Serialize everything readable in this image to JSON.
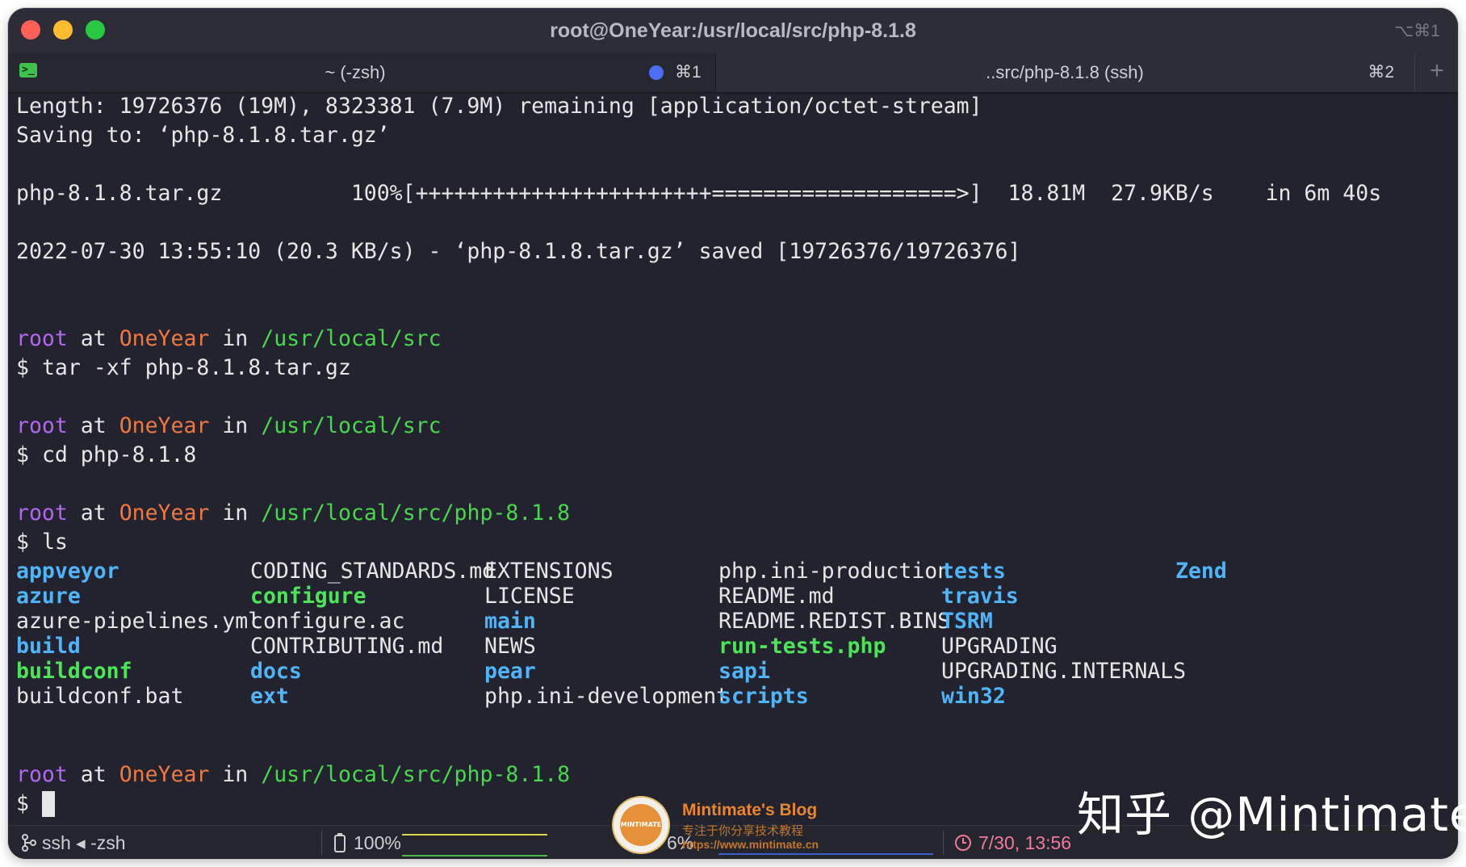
{
  "window": {
    "title": "root@OneYear:/usr/local/src/php-8.1.8",
    "shortcut": "⌥⌘1"
  },
  "tabs": [
    {
      "label": "~ (-zsh)",
      "shortcut": "⌘1"
    },
    {
      "label": "..src/php-8.1.8 (ssh)",
      "shortcut": "⌘2"
    }
  ],
  "tab_add_label": "+",
  "terminal": {
    "download": {
      "length_line": "Length: 19726376 (19M), 8323381 (7.9M) remaining [application/octet-stream]",
      "saving_line": "Saving to: ‘php-8.1.8.tar.gz’",
      "progress_line": "php-8.1.8.tar.gz          100%[+++++++++++++++++++++++===================>]  18.81M  27.9KB/s    in 6m 40s",
      "saved_line": "2022-07-30 13:55:10 (20.3 KB/s) - ‘php-8.1.8.tar.gz’ saved [19726376/19726376]"
    },
    "prompt": {
      "user": "root",
      "at": "at",
      "host": "OneYear",
      "in": "in",
      "symbol": "$"
    },
    "paths": {
      "src": "/usr/local/src",
      "php": "/usr/local/src/php-8.1.8"
    },
    "commands": [
      "tar -xf php-8.1.8.tar.gz",
      "cd php-8.1.8",
      "ls"
    ],
    "ls_columns": [
      [
        {
          "name": "appveyor",
          "kind": "dir"
        },
        {
          "name": "azure",
          "kind": "dir"
        },
        {
          "name": "azure-pipelines.yml",
          "kind": "file"
        },
        {
          "name": "build",
          "kind": "dir"
        },
        {
          "name": "buildconf",
          "kind": "exec"
        },
        {
          "name": "buildconf.bat",
          "kind": "file"
        }
      ],
      [
        {
          "name": "CODING_STANDARDS.md",
          "kind": "file"
        },
        {
          "name": "configure",
          "kind": "exec"
        },
        {
          "name": "configure.ac",
          "kind": "file"
        },
        {
          "name": "CONTRIBUTING.md",
          "kind": "file"
        },
        {
          "name": "docs",
          "kind": "dir"
        },
        {
          "name": "ext",
          "kind": "dir"
        }
      ],
      [
        {
          "name": "EXTENSIONS",
          "kind": "file"
        },
        {
          "name": "LICENSE",
          "kind": "file"
        },
        {
          "name": "main",
          "kind": "dir"
        },
        {
          "name": "NEWS",
          "kind": "file"
        },
        {
          "name": "pear",
          "kind": "dir"
        },
        {
          "name": "php.ini-development",
          "kind": "file"
        }
      ],
      [
        {
          "name": "php.ini-production",
          "kind": "file"
        },
        {
          "name": "README.md",
          "kind": "file"
        },
        {
          "name": "README.REDIST.BINS",
          "kind": "file"
        },
        {
          "name": "run-tests.php",
          "kind": "exec"
        },
        {
          "name": "sapi",
          "kind": "dir"
        },
        {
          "name": "scripts",
          "kind": "dir"
        }
      ],
      [
        {
          "name": "tests",
          "kind": "dir"
        },
        {
          "name": "travis",
          "kind": "dir"
        },
        {
          "name": "TSRM",
          "kind": "dir"
        },
        {
          "name": "UPGRADING",
          "kind": "file"
        },
        {
          "name": "UPGRADING.INTERNALS",
          "kind": "file"
        },
        {
          "name": "win32",
          "kind": "dir"
        }
      ],
      [
        {
          "name": "Zend",
          "kind": "dir"
        }
      ]
    ]
  },
  "statusbar": {
    "job": "ssh ◂ -zsh",
    "battery": "100%",
    "cpu": "6%",
    "clock": "7/30, 13:56"
  },
  "watermark": {
    "zhihu": "知乎 @Mintimate",
    "blog_title": "Mintimate's Blog",
    "blog_sub": "专注于你分享技术教程",
    "blog_url": "https://www.mintimate.cn",
    "logo_text": "MINTIMATE"
  },
  "colors": {
    "background": "#22232e",
    "user": "#b168ef",
    "host": "#f0793f",
    "path": "#48d84b",
    "directory": "#4fb5f8",
    "executable": "#4de45a",
    "text": "#e6e6e6"
  },
  "icons": {
    "tab1": "terminal-icon",
    "tab1_status": "activity-dot-icon",
    "job": "branch-icon",
    "battery": "battery-icon",
    "cpu": "cpu-icon",
    "clock": "clock-icon"
  }
}
